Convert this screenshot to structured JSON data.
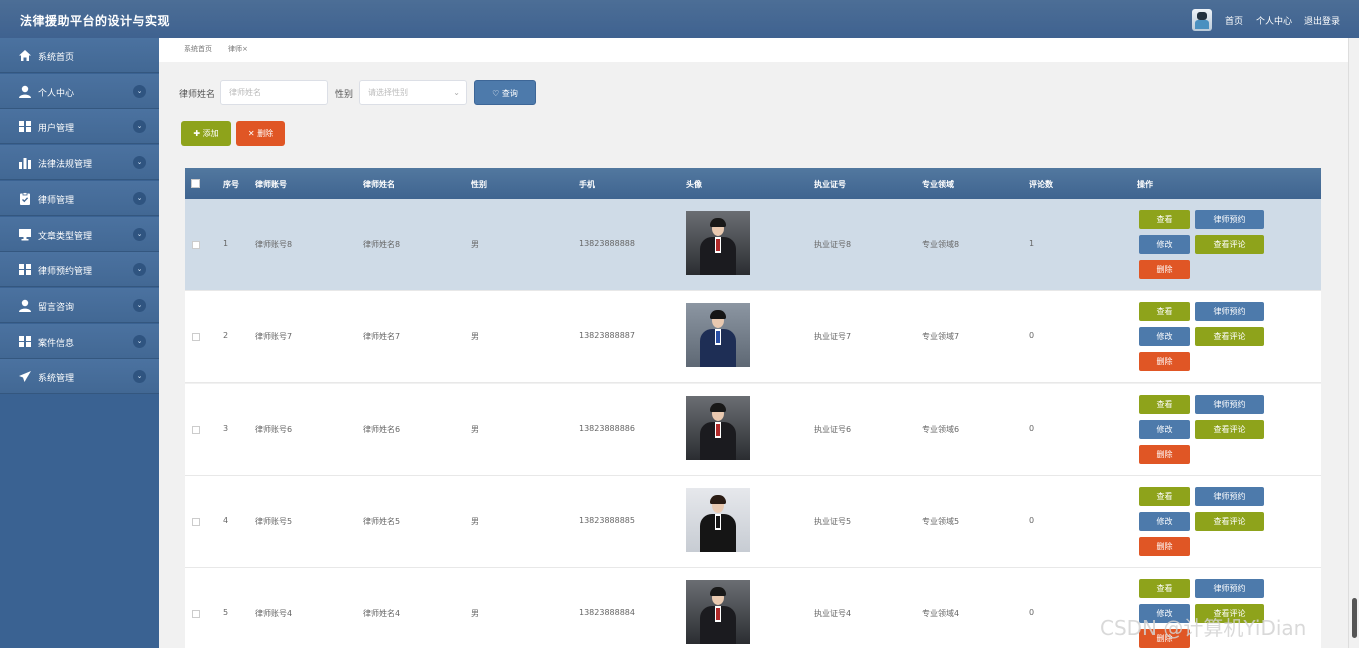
{
  "app": {
    "title": "法律援助平台的设计与实现"
  },
  "topnav": {
    "home": "首页",
    "profile": "个人中心",
    "logout": "退出登录"
  },
  "sidebar": {
    "items": [
      {
        "label": "系统首页",
        "icon": "home-icon",
        "chevron": false
      },
      {
        "label": "个人中心",
        "icon": "user-icon",
        "chevron": true
      },
      {
        "label": "用户管理",
        "icon": "grid-icon",
        "chevron": true
      },
      {
        "label": "法律法规管理",
        "icon": "bar-chart-icon",
        "chevron": true
      },
      {
        "label": "律师管理",
        "icon": "clipboard-icon",
        "chevron": true
      },
      {
        "label": "文章类型管理",
        "icon": "monitor-icon",
        "chevron": true
      },
      {
        "label": "律师预约管理",
        "icon": "grid-icon",
        "chevron": true
      },
      {
        "label": "留言咨询",
        "icon": "user-icon",
        "chevron": true
      },
      {
        "label": "案件信息",
        "icon": "grid-icon",
        "chevron": true
      },
      {
        "label": "系统管理",
        "icon": "send-icon",
        "chevron": true
      }
    ]
  },
  "breadcrumb": {
    "home": "系统首页",
    "current": "律师×"
  },
  "search": {
    "name_label": "律师姓名",
    "name_placeholder": "律师姓名",
    "gender_label": "性别",
    "gender_placeholder": "请选择性别",
    "search_button": "查询"
  },
  "actions": {
    "add": "添加",
    "delete": "删除"
  },
  "table": {
    "headers": [
      "序号",
      "律师账号",
      "律师姓名",
      "性别",
      "手机",
      "头像",
      "执业证号",
      "专业领域",
      "评论数",
      "操作"
    ],
    "rows": [
      {
        "no": "1",
        "account": "律师账号8",
        "name": "律师姓名8",
        "gender": "男",
        "phone": "13823888888",
        "license": "执业证号8",
        "field": "专业领域8",
        "comments": "1",
        "photo": "female-a"
      },
      {
        "no": "2",
        "account": "律师账号7",
        "name": "律师姓名7",
        "gender": "男",
        "phone": "13823888887",
        "license": "执业证号7",
        "field": "专业领域7",
        "comments": "0",
        "photo": "male"
      },
      {
        "no": "3",
        "account": "律师账号6",
        "name": "律师姓名6",
        "gender": "男",
        "phone": "13823888886",
        "license": "执业证号6",
        "field": "专业领域6",
        "comments": "0",
        "photo": "female-a"
      },
      {
        "no": "4",
        "account": "律师账号5",
        "name": "律师姓名5",
        "gender": "男",
        "phone": "13823888885",
        "license": "执业证号5",
        "field": "专业领域5",
        "comments": "0",
        "photo": "female-b"
      },
      {
        "no": "5",
        "account": "律师账号4",
        "name": "律师姓名4",
        "gender": "男",
        "phone": "13823888884",
        "license": "执业证号4",
        "field": "专业领域4",
        "comments": "0",
        "photo": "female-a"
      }
    ],
    "row_actions": {
      "view": "查看",
      "reserve": "律师预约",
      "edit": "修改",
      "view_comments": "查看评论",
      "delete": "删除"
    }
  },
  "watermark": "CSDN @计算机YiDian",
  "colors": {
    "header": "#4c6e96",
    "sidebar": "#426894",
    "green": "#8ea31b",
    "blue": "#4d7aab",
    "red": "#e05625",
    "selected_row": "#cfdbe7"
  }
}
